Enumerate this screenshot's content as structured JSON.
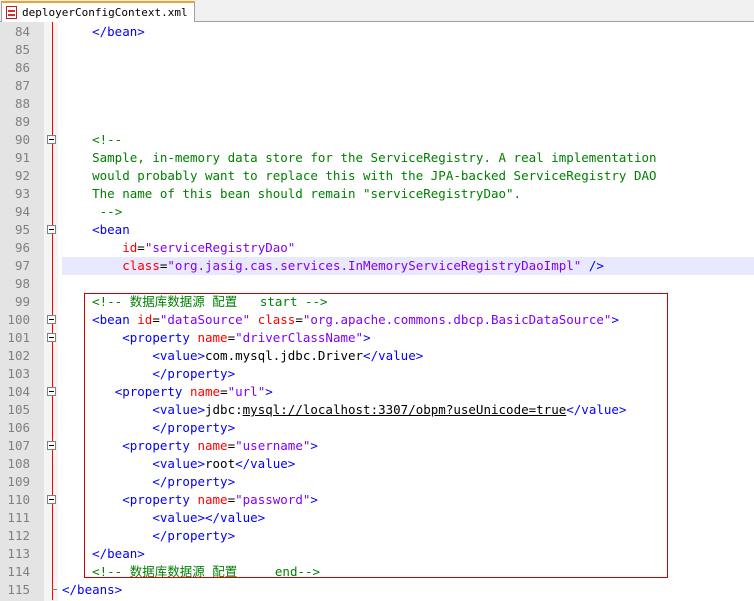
{
  "tab": {
    "label": "deployerConfigContext.xml",
    "icon": "xml-file-icon"
  },
  "colors": {
    "comment": "#008000",
    "tag": "#0000ff",
    "attribute": "#ff0000",
    "string": "#8000ff",
    "highlight_box": "#d00000"
  },
  "lines": [
    {
      "n": "84",
      "indent": "    ",
      "parts": [
        {
          "t": "</bean>",
          "c": "tag"
        }
      ]
    },
    {
      "n": "85",
      "indent": "",
      "parts": []
    },
    {
      "n": "86",
      "indent": "",
      "parts": []
    },
    {
      "n": "87",
      "indent": "",
      "parts": []
    },
    {
      "n": "88",
      "indent": "",
      "parts": []
    },
    {
      "n": "89",
      "indent": "",
      "parts": []
    },
    {
      "n": "90",
      "indent": "    ",
      "fold": true,
      "parts": [
        {
          "t": "<!--",
          "c": "com"
        }
      ]
    },
    {
      "n": "91",
      "indent": "    ",
      "parts": [
        {
          "t": "Sample, in-memory data store for the ServiceRegistry. A real implementation",
          "c": "com"
        }
      ]
    },
    {
      "n": "92",
      "indent": "    ",
      "parts": [
        {
          "t": "would probably want to replace this with the JPA-backed ServiceRegistry DAO",
          "c": "com"
        }
      ]
    },
    {
      "n": "93",
      "indent": "    ",
      "parts": [
        {
          "t": "The name of this bean should remain \"serviceRegistryDao\".",
          "c": "com"
        }
      ]
    },
    {
      "n": "94",
      "indent": "     ",
      "parts": [
        {
          "t": "-->",
          "c": "com"
        }
      ]
    },
    {
      "n": "95",
      "indent": "    ",
      "fold": true,
      "parts": [
        {
          "t": "<bean",
          "c": "tag"
        }
      ]
    },
    {
      "n": "96",
      "indent": "        ",
      "parts": [
        {
          "t": "id",
          "c": "attr"
        },
        {
          "t": "=",
          "c": "txt"
        },
        {
          "t": "\"serviceRegistryDao\"",
          "c": "str"
        }
      ]
    },
    {
      "n": "97",
      "indent": "        ",
      "hl": true,
      "parts": [
        {
          "t": "class",
          "c": "attr"
        },
        {
          "t": "=",
          "c": "txt"
        },
        {
          "t": "\"org.jasig.cas.services.InMemoryServiceRegistryDaoImpl\"",
          "c": "str"
        },
        {
          "t": " />",
          "c": "tag"
        }
      ]
    },
    {
      "n": "98",
      "indent": "",
      "parts": []
    },
    {
      "n": "99",
      "indent": "    ",
      "parts": [
        {
          "t": "<!-- 数据库数据源 配置   start -->",
          "c": "com"
        }
      ]
    },
    {
      "n": "100",
      "indent": "    ",
      "fold": true,
      "parts": [
        {
          "t": "<bean ",
          "c": "tag"
        },
        {
          "t": "id",
          "c": "attr"
        },
        {
          "t": "=",
          "c": "txt"
        },
        {
          "t": "\"dataSource\"",
          "c": "str"
        },
        {
          "t": " class",
          "c": "attr"
        },
        {
          "t": "=",
          "c": "txt"
        },
        {
          "t": "\"org.apache.commons.dbcp.BasicDataSource\"",
          "c": "str"
        },
        {
          "t": ">",
          "c": "tag"
        }
      ]
    },
    {
      "n": "101",
      "indent": "        ",
      "fold": true,
      "parts": [
        {
          "t": "<property ",
          "c": "tag"
        },
        {
          "t": "name",
          "c": "attr"
        },
        {
          "t": "=",
          "c": "txt"
        },
        {
          "t": "\"driverClassName\"",
          "c": "str"
        },
        {
          "t": ">",
          "c": "tag"
        }
      ]
    },
    {
      "n": "102",
      "indent": "            ",
      "parts": [
        {
          "t": "<value>",
          "c": "tag"
        },
        {
          "t": "com.mysql.jdbc.Driver",
          "c": "txt"
        },
        {
          "t": "</value>",
          "c": "tag"
        }
      ]
    },
    {
      "n": "103",
      "indent": "            ",
      "parts": [
        {
          "t": "</property>",
          "c": "tag"
        }
      ]
    },
    {
      "n": "104",
      "indent": "       ",
      "fold": true,
      "parts": [
        {
          "t": "<property ",
          "c": "tag"
        },
        {
          "t": "name",
          "c": "attr"
        },
        {
          "t": "=",
          "c": "txt"
        },
        {
          "t": "\"url\"",
          "c": "str"
        },
        {
          "t": ">",
          "c": "tag"
        }
      ]
    },
    {
      "n": "105",
      "indent": "            ",
      "parts": [
        {
          "t": "<value>",
          "c": "tag"
        },
        {
          "t": "jdbc:",
          "c": "txt"
        },
        {
          "t": "mysql://localhost:3307/obpm?useUnicode=true",
          "c": "txt",
          "u": true
        },
        {
          "t": "</value>",
          "c": "tag"
        }
      ]
    },
    {
      "n": "106",
      "indent": "            ",
      "parts": [
        {
          "t": "</property>",
          "c": "tag"
        }
      ]
    },
    {
      "n": "107",
      "indent": "        ",
      "fold": true,
      "parts": [
        {
          "t": "<property ",
          "c": "tag"
        },
        {
          "t": "name",
          "c": "attr"
        },
        {
          "t": "=",
          "c": "txt"
        },
        {
          "t": "\"username\"",
          "c": "str"
        },
        {
          "t": ">",
          "c": "tag"
        }
      ]
    },
    {
      "n": "108",
      "indent": "            ",
      "parts": [
        {
          "t": "<value>",
          "c": "tag"
        },
        {
          "t": "root",
          "c": "txt"
        },
        {
          "t": "</value>",
          "c": "tag"
        }
      ]
    },
    {
      "n": "109",
      "indent": "            ",
      "parts": [
        {
          "t": "</property>",
          "c": "tag"
        }
      ]
    },
    {
      "n": "110",
      "indent": "        ",
      "fold": true,
      "parts": [
        {
          "t": "<property ",
          "c": "tag"
        },
        {
          "t": "name",
          "c": "attr"
        },
        {
          "t": "=",
          "c": "txt"
        },
        {
          "t": "\"password\"",
          "c": "str"
        },
        {
          "t": ">",
          "c": "tag"
        }
      ]
    },
    {
      "n": "111",
      "indent": "            ",
      "parts": [
        {
          "t": "<value></value>",
          "c": "tag"
        }
      ]
    },
    {
      "n": "112",
      "indent": "            ",
      "parts": [
        {
          "t": "</property>",
          "c": "tag"
        }
      ]
    },
    {
      "n": "113",
      "indent": "    ",
      "parts": [
        {
          "t": "</bean>",
          "c": "tag"
        }
      ]
    },
    {
      "n": "114",
      "indent": "    ",
      "parts": [
        {
          "t": "<!-- 数据库数据源 配置     end-->",
          "c": "com"
        }
      ]
    },
    {
      "n": "115",
      "indent": "",
      "parts": [
        {
          "t": "</beans>",
          "c": "tag"
        }
      ]
    }
  ]
}
